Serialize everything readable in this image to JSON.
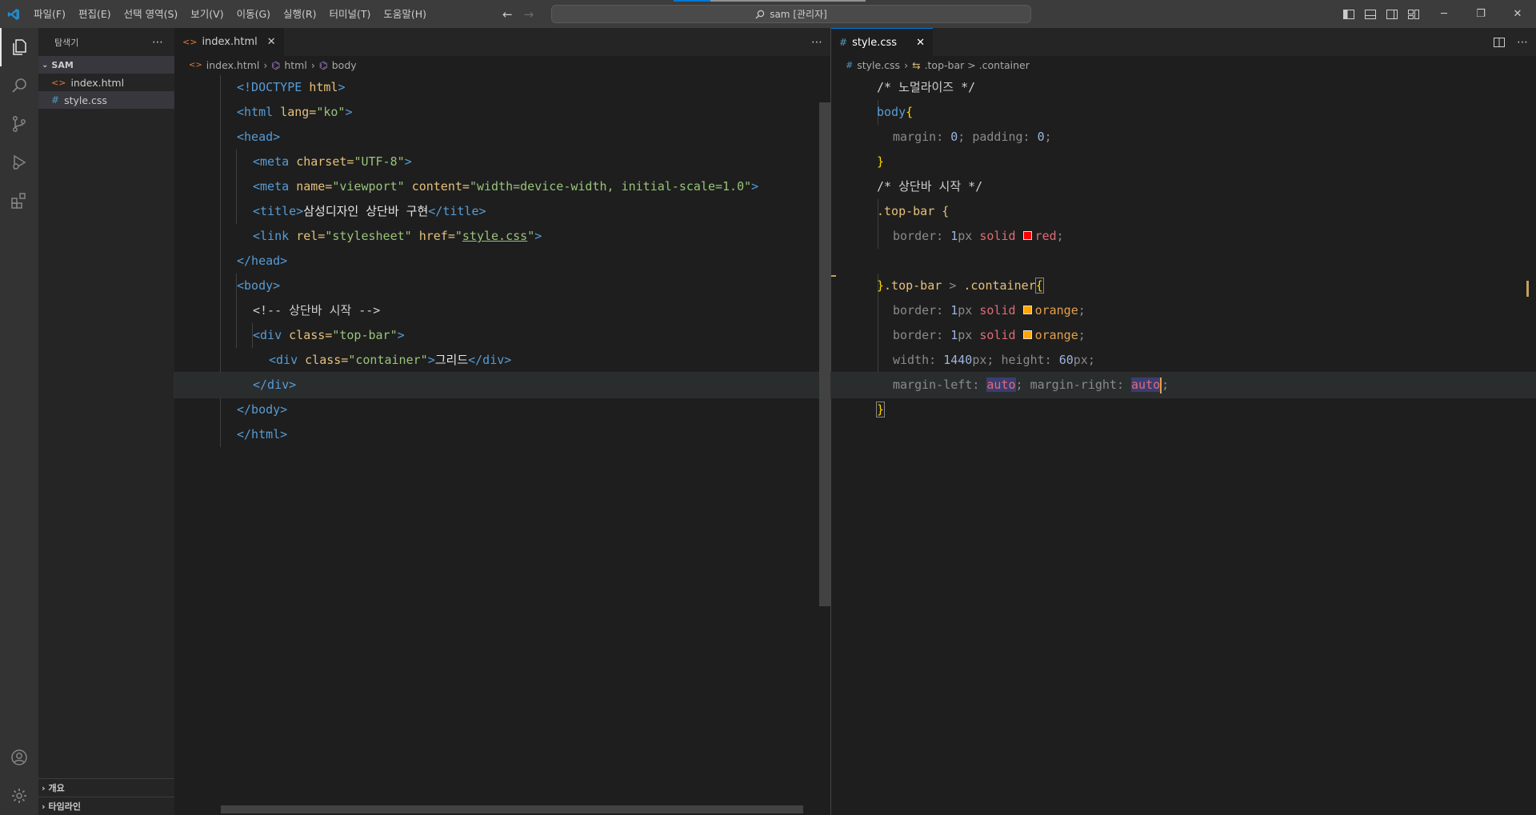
{
  "menu": [
    "파일(F)",
    "편집(E)",
    "선택 영역(S)",
    "보기(V)",
    "이동(G)",
    "실행(R)",
    "터미널(T)",
    "도움말(H)"
  ],
  "command_center": {
    "text": "sam [관리자]"
  },
  "colors": {
    "accent": "#0078d4",
    "editor_bg": "#1e1e1e",
    "sidebar_bg": "#252526",
    "activity_bg": "#333333"
  },
  "activity": [
    "files-icon",
    "search-icon",
    "source-control-icon",
    "run-debug-icon",
    "extensions-icon",
    "account-icon",
    "settings-gear-icon"
  ],
  "sidebar": {
    "title": "탐색기",
    "folder": "SAM",
    "files": [
      {
        "name": "index.html",
        "icon": "html-file-icon"
      },
      {
        "name": "style.css",
        "icon": "css-file-icon"
      }
    ],
    "bottom_sections": [
      "개요",
      "타임라인"
    ]
  },
  "left_editor": {
    "tab": "index.html",
    "breadcrumb": [
      "index.html",
      "html",
      "body"
    ],
    "lines": [
      "<!DOCTYPE html>",
      "<html lang=\"ko\">",
      "<head>",
      "<meta charset=\"UTF-8\">",
      "<meta name=\"viewport\" content=\"width=device-width, initial-scale=1.0\">",
      "<title>삼성디자인 상단바 구현</title>",
      "<link rel=\"stylesheet\" href=\"style.css\">",
      "</head>",
      "<body>",
      "<!-- 상단바 시작 -->",
      "<div class=\"top-bar\">",
      "<div class=\"container\">그리드</div>",
      "</div>",
      "</body>",
      "</html>"
    ]
  },
  "right_editor": {
    "tab": "style.css",
    "breadcrumb": [
      "style.css",
      ".top-bar > .container"
    ],
    "lines": [
      "/* 노멀라이즈 */",
      "body{",
      "margin: 0; padding: 0;",
      "}",
      "/* 상단바 시작 */",
      ".top-bar {",
      "border: 1px solid red;",
      "",
      "}.top-bar > .container{",
      "border: 1px solid orange;",
      "border: 1px solid orange;",
      "width: 1440px; height: 60px;",
      "margin-left: auto; margin-right: auto;",
      "}"
    ]
  }
}
